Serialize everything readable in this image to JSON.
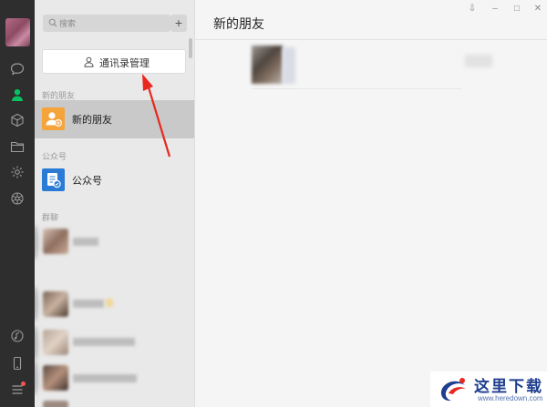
{
  "search": {
    "placeholder": "搜索"
  },
  "panel": {
    "add_button": "+",
    "manage_button": "通讯录管理",
    "sections": {
      "new_friends": "新的朋友",
      "official": "公众号",
      "groups": "群聊"
    },
    "rows": {
      "new_friends": "新的朋友",
      "official": "公众号"
    }
  },
  "main": {
    "title": "新的朋友"
  },
  "window": {
    "pin": "⇩",
    "minimize": "–",
    "maximize": "□",
    "close": "✕"
  },
  "icons": [
    "chat-icon",
    "contacts-icon",
    "box-icon",
    "folder-icon",
    "gear-icon",
    "settings-icon",
    "music-icon",
    "phone-icon",
    "menu-icon"
  ],
  "colors": {
    "accent": "#07c160",
    "annotation": "#e8281f",
    "new_friend_icon": "#f5a33b",
    "official_icon": "#2a7bd6"
  },
  "watermark": {
    "brand": "这里下载",
    "url": "www.heredown.com"
  }
}
